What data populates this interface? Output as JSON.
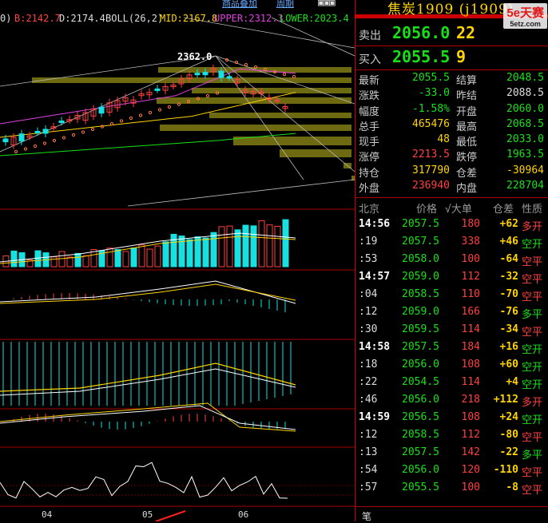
{
  "top": {
    "menu": [
      "商品叠加",
      "周期"
    ],
    "boll_prefix": "0)",
    "b_label": "B:2142.7",
    "d_label": "D:2174.4",
    "boll_label": "BOLL(26,2)",
    "mid_label": "MID:2167.8",
    "upper_label": "UPPER:2312.3",
    "lower_label": "LOWER:2023.4",
    "peak_label": "2362.0"
  },
  "dates": [
    "04",
    "05",
    "06"
  ],
  "colors": {
    "up": "#ff4040",
    "down": "#18e0e0",
    "green": "#18e018",
    "yellow": "#ffd400",
    "panel_border": "#c00000"
  },
  "panel": {
    "title": "焦炭1909 (j1909)",
    "logo_text": "5e天赛",
    "logo_sub": "5etz.com",
    "sell_label": "卖出",
    "sell_price": "2056.0",
    "sell_qty": "22",
    "buy_label": "买入",
    "buy_price": "2055.5",
    "buy_qty": "9",
    "stats": [
      {
        "k1": "最新",
        "v1": "2055.5",
        "c1": "g",
        "k2": "结算",
        "v2": "2048.5",
        "c2": "g"
      },
      {
        "k1": "涨跌",
        "v1": "-33.0",
        "c1": "g",
        "k2": "昨结",
        "v2": "2088.5",
        "c2": "w"
      },
      {
        "k1": "幅度",
        "v1": "-1.58%",
        "c1": "g",
        "k2": "开盘",
        "v2": "2060.0",
        "c2": "g"
      },
      {
        "k1": "总手",
        "v1": "465476",
        "c1": "y",
        "k2": "最高",
        "v2": "2068.5",
        "c2": "g"
      },
      {
        "k1": "现手",
        "v1": "48",
        "c1": "y",
        "k2": "最低",
        "v2": "2033.0",
        "c2": "g"
      },
      {
        "k1": "涨停",
        "v1": "2213.5",
        "c1": "r",
        "k2": "跌停",
        "v2": "1963.5",
        "c2": "g"
      },
      {
        "k1": "持仓",
        "v1": "317790",
        "c1": "y",
        "k2": "仓差",
        "v2": "-30964",
        "c2": "y"
      },
      {
        "k1": "外盘",
        "v1": "236940",
        "c1": "r",
        "k2": "内盘",
        "v2": "228704",
        "c2": "g"
      }
    ],
    "ticks_header": {
      "loc": "北京",
      "price": "价格",
      "vol": "√大单",
      "diff": "仓差",
      "nature": "性质"
    },
    "ticks": [
      {
        "time": "14:56",
        "main": true,
        "price": "2057.5",
        "vol": "180",
        "diff": "+62",
        "nature": "多开",
        "pc": "g",
        "dc": "y",
        "nc": "r"
      },
      {
        "time": ":19",
        "main": false,
        "price": "2057.5",
        "vol": "338",
        "diff": "+46",
        "nature": "空开",
        "pc": "g",
        "dc": "y",
        "nc": "g"
      },
      {
        "time": ":53",
        "main": false,
        "price": "2058.0",
        "vol": "100",
        "diff": "-64",
        "nature": "空平",
        "pc": "g",
        "dc": "y",
        "nc": "r"
      },
      {
        "time": "14:57",
        "main": true,
        "price": "2059.0",
        "vol": "112",
        "diff": "-32",
        "nature": "空平",
        "pc": "g",
        "dc": "y",
        "nc": "r"
      },
      {
        "time": ":04",
        "main": false,
        "price": "2058.5",
        "vol": "110",
        "diff": "-70",
        "nature": "空平",
        "pc": "g",
        "dc": "y",
        "nc": "r"
      },
      {
        "time": ":12",
        "main": false,
        "price": "2059.0",
        "vol": "166",
        "diff": "-76",
        "nature": "多平",
        "pc": "g",
        "dc": "y",
        "nc": "g"
      },
      {
        "time": ":30",
        "main": false,
        "price": "2059.5",
        "vol": "114",
        "diff": "-34",
        "nature": "空平",
        "pc": "g",
        "dc": "y",
        "nc": "r"
      },
      {
        "time": "14:58",
        "main": true,
        "price": "2057.5",
        "vol": "184",
        "diff": "+16",
        "nature": "空开",
        "pc": "g",
        "dc": "y",
        "nc": "g"
      },
      {
        "time": ":18",
        "main": false,
        "price": "2056.0",
        "vol": "108",
        "diff": "+60",
        "nature": "空开",
        "pc": "g",
        "dc": "y",
        "nc": "g"
      },
      {
        "time": ":22",
        "main": false,
        "price": "2054.5",
        "vol": "114",
        "diff": "+4",
        "nature": "空开",
        "pc": "g",
        "dc": "y",
        "nc": "g"
      },
      {
        "time": ":46",
        "main": false,
        "price": "2056.0",
        "vol": "218",
        "diff": "+112",
        "nature": "多开",
        "pc": "g",
        "dc": "y",
        "nc": "r"
      },
      {
        "time": "14:59",
        "main": true,
        "price": "2056.5",
        "vol": "108",
        "diff": "+24",
        "nature": "空开",
        "pc": "g",
        "dc": "y",
        "nc": "g"
      },
      {
        "time": ":12",
        "main": false,
        "price": "2058.5",
        "vol": "112",
        "diff": "-80",
        "nature": "空平",
        "pc": "g",
        "dc": "y",
        "nc": "r"
      },
      {
        "time": ":13",
        "main": false,
        "price": "2057.5",
        "vol": "142",
        "diff": "-22",
        "nature": "多平",
        "pc": "g",
        "dc": "y",
        "nc": "g"
      },
      {
        "time": ":54",
        "main": false,
        "price": "2056.0",
        "vol": "120",
        "diff": "-110",
        "nature": "空平",
        "pc": "g",
        "dc": "y",
        "nc": "r"
      },
      {
        "time": ":57",
        "main": false,
        "price": "2055.5",
        "vol": "100",
        "diff": "-8",
        "nature": "空平",
        "pc": "g",
        "dc": "y",
        "nc": "r"
      }
    ],
    "bottom_tab": "笔"
  }
}
